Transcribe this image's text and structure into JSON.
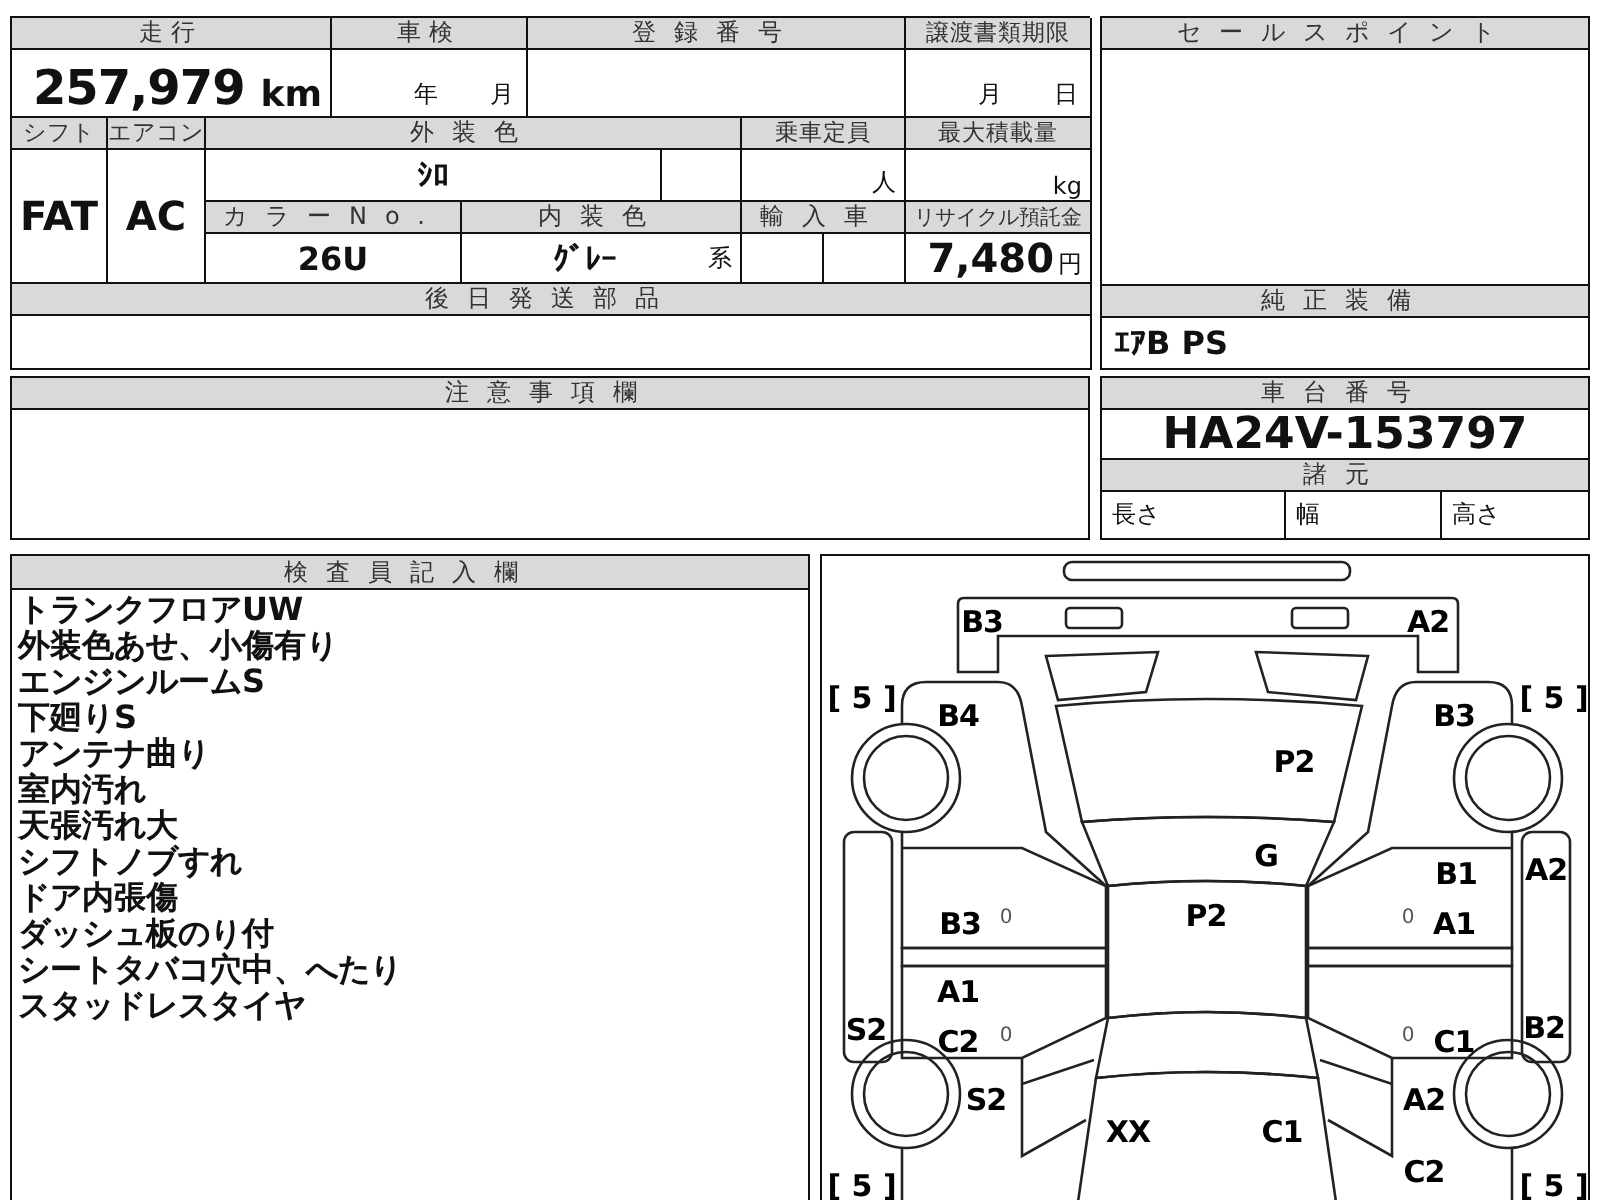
{
  "vehicle_table": {
    "mileage_label": "走行",
    "mileage": "257,979",
    "mileage_unit": "km",
    "inspection_label": "車検",
    "inspection_year": "年",
    "inspection_month": "月",
    "registration_label": "登録番号",
    "transfer_label": "譲渡書類期限",
    "transfer_month": "月",
    "transfer_day": "日",
    "shift_label": "シフト",
    "shift": "FAT",
    "aircon_label": "エアコン",
    "aircon": "AC",
    "exterior_color_label": "外装色",
    "exterior_color": "ｼﾛ",
    "capacity_label": "乗車定員",
    "capacity_unit": "人",
    "max_load_label": "最大積載量",
    "max_load_unit": "kg",
    "color_no_label": "カラーNo.",
    "color_no": "26U",
    "interior_color_label": "内装色",
    "interior_color": "ｸﾞﾚｰ",
    "interior_color_suffix": "系",
    "import_label": "輸入車",
    "recycle_label": "リサイクル預託金",
    "recycle_fee": "7,480",
    "recycle_unit": "円",
    "later_parts_label": "後日発送部品"
  },
  "sales_point": {
    "label": "セールスポイント"
  },
  "equipment": {
    "label": "純正装備",
    "value": "ｴｱB PS"
  },
  "notes": {
    "label": "注意事項欄"
  },
  "chassis": {
    "label": "車台番号",
    "value": "HA24V-153797"
  },
  "specs": {
    "label": "諸元",
    "cells": [
      "長さ",
      "幅",
      "高さ"
    ]
  },
  "inspector": {
    "label": "検査員記入欄",
    "lines": [
      "トランクフロアUW",
      "外装色あせ、小傷有り",
      "エンジンルームS",
      "下廻りS",
      "アンテナ曲り",
      "室内汚れ",
      "天張汚れ大",
      "シフトノブすれ",
      "ドア内張傷",
      "ダッシュ板のり付",
      "シートタバコ穴中、へたり",
      "スタッドレスタイヤ"
    ]
  },
  "diagram": {
    "marks": [
      {
        "kind": "code",
        "text": "B3"
      },
      {
        "kind": "code",
        "text": "A2"
      },
      {
        "kind": "tread",
        "text": "[ 5 ]"
      },
      {
        "kind": "tread",
        "text": "[ 5 ]"
      },
      {
        "kind": "code",
        "text": "B4"
      },
      {
        "kind": "code",
        "text": "B3"
      },
      {
        "kind": "code",
        "text": "P2"
      },
      {
        "kind": "code",
        "text": "G"
      },
      {
        "kind": "code",
        "text": "B1"
      },
      {
        "kind": "code",
        "text": "A2"
      },
      {
        "kind": "code",
        "text": "B3"
      },
      {
        "kind": "small",
        "text": "0"
      },
      {
        "kind": "code",
        "text": "P2"
      },
      {
        "kind": "small",
        "text": "0"
      },
      {
        "kind": "code",
        "text": "A1"
      },
      {
        "kind": "code",
        "text": "A1"
      },
      {
        "kind": "code",
        "text": "S2"
      },
      {
        "kind": "code",
        "text": "C2"
      },
      {
        "kind": "small",
        "text": "0"
      },
      {
        "kind": "small",
        "text": "0"
      },
      {
        "kind": "code",
        "text": "C1"
      },
      {
        "kind": "code",
        "text": "B2"
      },
      {
        "kind": "code",
        "text": "S2"
      },
      {
        "kind": "code",
        "text": "A2"
      },
      {
        "kind": "code",
        "text": "XX"
      },
      {
        "kind": "code",
        "text": "C1"
      },
      {
        "kind": "code",
        "text": "C2"
      },
      {
        "kind": "tread",
        "text": "[ 5 ]"
      },
      {
        "kind": "tread",
        "text": "[ 5 ]"
      }
    ]
  }
}
